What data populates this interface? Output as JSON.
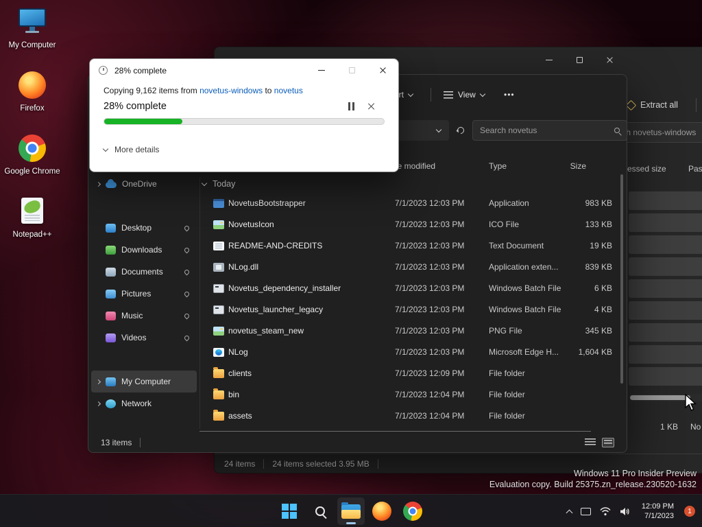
{
  "desktop": {
    "icons": [
      {
        "label": "My Computer",
        "icon": "computer"
      },
      {
        "label": "Firefox",
        "icon": "firefox"
      },
      {
        "label": "Google Chrome",
        "icon": "chrome"
      },
      {
        "label": "Notepad++",
        "icon": "notepad"
      }
    ],
    "watermark_line1": "Windows 11 Pro Insider Preview",
    "watermark_line2": "Evaluation copy. Build 25375.zn_release.230520-1632"
  },
  "copy_dialog": {
    "title": "28% complete",
    "body_prefix": "Copying 9,162 items from ",
    "source_link": "novetus-windows",
    "body_connector": " to ",
    "dest_link": "novetus",
    "percent_label": "28% complete",
    "percent": 28,
    "more_details_label": "More details",
    "progress_color": "#17b225",
    "link_color": "#0a5cb8"
  },
  "explorer": {
    "toolbar": {
      "sort_label": "Sort",
      "view_label": "View",
      "more_label": "•••"
    },
    "search_text": "Search novetus",
    "columns": {
      "date": "Date modified",
      "type": "Type",
      "size": "Size"
    },
    "group_label": "Today",
    "files": [
      {
        "name": "NovetusBootstrapper",
        "date": "7/1/2023 12:03 PM",
        "type": "Application",
        "size": "983 KB",
        "icon": "app"
      },
      {
        "name": "NovetusIcon",
        "date": "7/1/2023 12:03 PM",
        "type": "ICO File",
        "size": "133 KB",
        "icon": "image"
      },
      {
        "name": "README-AND-CREDITS",
        "date": "7/1/2023 12:03 PM",
        "type": "Text Document",
        "size": "19 KB",
        "icon": "text"
      },
      {
        "name": "NLog.dll",
        "date": "7/1/2023 12:03 PM",
        "type": "Application exten...",
        "size": "839 KB",
        "icon": "dll"
      },
      {
        "name": "Novetus_dependency_installer",
        "date": "7/1/2023 12:03 PM",
        "type": "Windows Batch File",
        "size": "6 KB",
        "icon": "bat"
      },
      {
        "name": "Novetus_launcher_legacy",
        "date": "7/1/2023 12:03 PM",
        "type": "Windows Batch File",
        "size": "4 KB",
        "icon": "bat"
      },
      {
        "name": "novetus_steam_new",
        "date": "7/1/2023 12:03 PM",
        "type": "PNG File",
        "size": "345 KB",
        "icon": "image"
      },
      {
        "name": "NLog",
        "date": "7/1/2023 12:03 PM",
        "type": "Microsoft Edge H...",
        "size": "1,604 KB",
        "icon": "edge"
      },
      {
        "name": "clients",
        "date": "7/1/2023 12:09 PM",
        "type": "File folder",
        "size": "",
        "icon": "folder"
      },
      {
        "name": "bin",
        "date": "7/1/2023 12:04 PM",
        "type": "File folder",
        "size": "",
        "icon": "folder"
      },
      {
        "name": "assets",
        "date": "7/1/2023 12:04 PM",
        "type": "File folder",
        "size": "",
        "icon": "folder"
      }
    ],
    "sidebar": {
      "items": [
        {
          "label": "OneDrive",
          "type": "onedrive",
          "chevron": true
        },
        {
          "label": "Desktop",
          "type": "desktop",
          "pinned": true,
          "gap_before": true
        },
        {
          "label": "Downloads",
          "type": "downloads",
          "pinned": true
        },
        {
          "label": "Documents",
          "type": "documents",
          "pinned": true
        },
        {
          "label": "Pictures",
          "type": "pictures",
          "pinned": true
        },
        {
          "label": "Music",
          "type": "music",
          "pinned": true
        },
        {
          "label": "Videos",
          "type": "videos",
          "pinned": true
        },
        {
          "label": "My Computer",
          "type": "computer",
          "chevron": true,
          "selected": true,
          "gap_before": true
        },
        {
          "label": "Network",
          "type": "network",
          "chevron": true
        }
      ]
    },
    "status_items": "13 items"
  },
  "zip_window": {
    "extract_all_label": "Extract all",
    "search_text": "Search novetus-windows",
    "columns": {
      "compressed": "Compressed size",
      "password": "Password"
    },
    "selected_rows": 9,
    "detail_size": "1 KB",
    "detail_password": "No",
    "status_items": "24 items",
    "status_selected": "24 items selected  3.95 MB"
  },
  "taskbar": {
    "icons": [
      {
        "name": "start"
      },
      {
        "name": "search"
      },
      {
        "name": "explorer",
        "active": true
      },
      {
        "name": "firefox"
      },
      {
        "name": "chrome"
      }
    ],
    "time": "12:09 PM",
    "date": "7/1/2023",
    "badge": "1"
  }
}
